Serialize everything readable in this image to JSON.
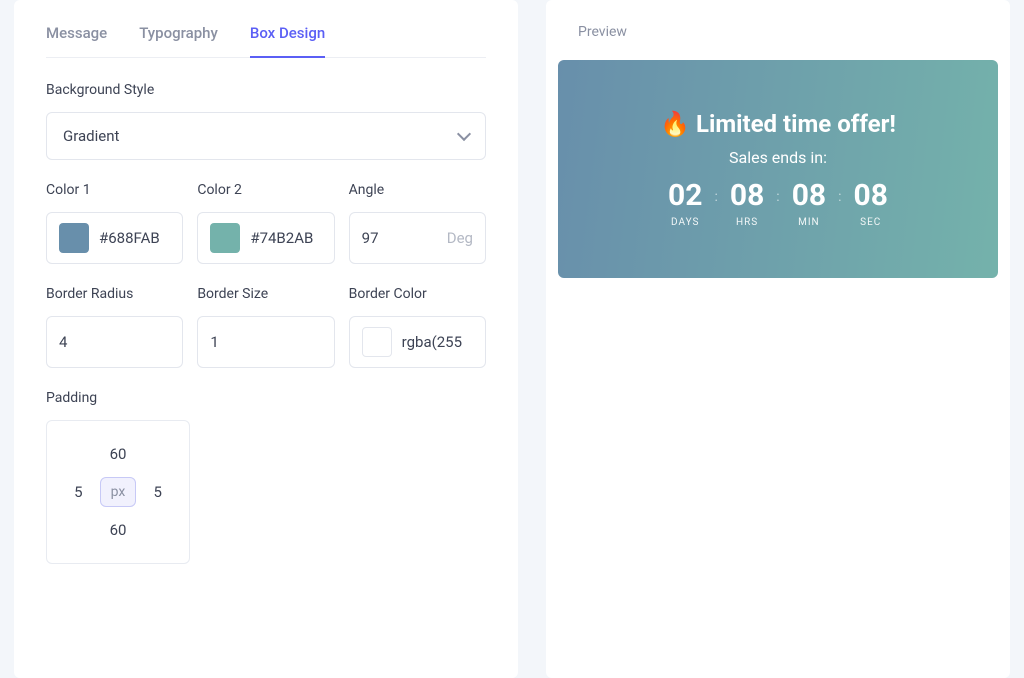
{
  "tabs": {
    "message": "Message",
    "typography": "Typography",
    "boxdesign": "Box Design"
  },
  "labels": {
    "background_style": "Background Style",
    "color1": "Color 1",
    "color2": "Color 2",
    "angle": "Angle",
    "border_radius": "Border Radius",
    "border_size": "Border Size",
    "border_color": "Border Color",
    "padding": "Padding"
  },
  "values": {
    "background_style": "Gradient",
    "color1_hex": "#688FAB",
    "color2_hex": "#74B2AB",
    "angle": "97",
    "angle_unit": "Deg",
    "border_radius": "4",
    "border_size": "1",
    "border_color": "rgba(255",
    "border_color_swatch": "#ffffff",
    "padding": {
      "top": "60",
      "right": "5",
      "bottom": "60",
      "left": "5",
      "unit": "px"
    }
  },
  "preview": {
    "label": "Preview",
    "emoji": "🔥",
    "title": "Limited time offer!",
    "subtitle": "Sales ends in:",
    "countdown": [
      {
        "num": "02",
        "label": "DAYS"
      },
      {
        "num": "08",
        "label": "HRS"
      },
      {
        "num": "08",
        "label": "MIN"
      },
      {
        "num": "08",
        "label": "SEC"
      }
    ]
  }
}
